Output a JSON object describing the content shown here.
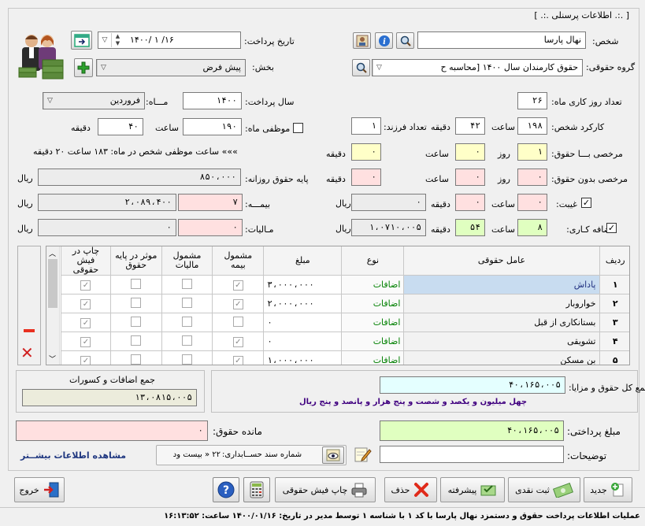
{
  "window_title": "[ .:. اطلاعات پرسنلی .:. ]",
  "person": {
    "label": "شخص:",
    "value": "نهال پارسا"
  },
  "pay_date": {
    "label": "تاریخ پرداخت:",
    "value": "۱۴۰۰/ ۱ /۱۶"
  },
  "salary_group": {
    "label": "گروه حقوقی:",
    "value": "حقوق کارمندان سال ۱۴۰۰ [محاسبه ح"
  },
  "section": {
    "label": "بخش:",
    "value": "پیش فرض"
  },
  "month_work_days": {
    "label": "تعداد روز کاری ماه:",
    "value": "۲۶"
  },
  "pay_year": {
    "label": "سال پرداخت:",
    "value": "۱۴۰۰"
  },
  "month": {
    "label": "مـــاه:",
    "value": "فروردین"
  },
  "person_work": {
    "label": "کارکرد شخص:",
    "hours": "۱۹۸",
    "hours_unit": "ساعت",
    "minutes": "۴۲",
    "minutes_unit": "دقیقه"
  },
  "children": {
    "label": "تعداد فرزند:",
    "value": "۱"
  },
  "month_duty": {
    "label": "موظفی ماه:",
    "hours": "۱۹۰",
    "hours_unit": "ساعت",
    "minutes": "۴۰",
    "minutes_unit": "دقیقه"
  },
  "leave_paid": {
    "label": "مرخصی بـــا حقوق:",
    "days": "۱",
    "days_unit": "روز",
    "hours": "۰",
    "hours_unit": "ساعت",
    "minutes": "۰",
    "minutes_unit": "دقیقه"
  },
  "over_duty_text": "»»» ساعت موظفی شخص در ماه: ۱۸۳ ساعت ۲۰ دقیقه",
  "leave_unpaid": {
    "label": "مرخصی بدون حقوق:",
    "days": "۰",
    "days_unit": "روز",
    "hours": "۰",
    "hours_unit": "ساعت",
    "minutes": "۰",
    "minutes_unit": "دقیقه"
  },
  "daily_base": {
    "label": "پایه حقوق روزانه:",
    "value": "۸۵۰،۰۰۰",
    "unit": "ریال"
  },
  "absence": {
    "label": "غیبت:",
    "checked": true,
    "hours": "۰",
    "hours_unit": "ساعت",
    "minutes": "۰",
    "minutes_unit": "دقیقه",
    "unit": "ریال"
  },
  "insurance": {
    "label": "بیمـــه:",
    "percent": "۷",
    "amount": "۲،۰۸۹،۴۰۰",
    "unit": "ریال"
  },
  "overtime": {
    "label": "اضافه کـاری:",
    "checked": true,
    "hours": "۸",
    "hours_unit": "ساعت",
    "minutes": "۵۴",
    "minutes_unit": "دقیقه",
    "amount": "۱،۰۷۱۰،۰۰۵",
    "unit": "ریال"
  },
  "tax": {
    "label": "مـالیات:",
    "percent": "۰",
    "amount": "۰",
    "unit": "ریال"
  },
  "table": {
    "headers": [
      "ردیف",
      "عامل حقوقی",
      "نوع",
      "مبلغ",
      "مشمول بیمه",
      "مشمول مالیات",
      "موثر در پایه حقوق",
      "چاپ در فیش حقوقی"
    ],
    "rows": [
      {
        "idx": "۱",
        "item": "پاداش",
        "type": "اضافات",
        "amount": "۳،۰۰۰،۰۰۰",
        "ins": true,
        "tax": false,
        "base": false,
        "print": true
      },
      {
        "idx": "۲",
        "item": "خواروبار",
        "type": "اضافات",
        "amount": "۲،۰۰۰،۰۰۰",
        "ins": true,
        "tax": false,
        "base": false,
        "print": true
      },
      {
        "idx": "۳",
        "item": "بستانکاری از قبل",
        "type": "اضافات",
        "amount": "۰",
        "ins": false,
        "tax": false,
        "base": false,
        "print": true
      },
      {
        "idx": "۴",
        "item": "تشویقی",
        "type": "اضافات",
        "amount": "۰",
        "ins": true,
        "tax": false,
        "base": false,
        "print": true
      },
      {
        "idx": "۵",
        "item": "بن مسکن",
        "type": "اضافات",
        "amount": "۱،۰۰۰،۰۰۰",
        "ins": true,
        "tax": false,
        "base": false,
        "print": true
      }
    ]
  },
  "total_benefits": {
    "label": "جمع کل حقوق و مزایا:",
    "value": "۴۰،۱۶۵،۰۰۵",
    "words": "چهل  میلیون و یکصد و شصت و پنج هزار و پانصد و  پنج ریال"
  },
  "total_add_deduct": {
    "label": "جمع اضافات و کسورات",
    "value": "۱۳،۰۸۱۵،۰۰۵"
  },
  "pay_amount": {
    "label": "مبلغ پرداختی:",
    "value": "۴۰،۱۶۵،۰۰۵"
  },
  "remaining": {
    "label": "مانده حقوق:",
    "value": "۰"
  },
  "description": {
    "label": "توضیحات:",
    "value": ""
  },
  "voucher": {
    "label": "شماره سند حســابداری:",
    "value": "۲۲ « بیست ود"
  },
  "more_info": "مشاهده اطلاعات بیشــتر",
  "buttons": {
    "new": "جدید",
    "cash": "ثبت نقدی",
    "advanced": "پیشرفته",
    "delete": "حذف",
    "print_slip": "چاپ فیش حقوقی",
    "exit": "خروج"
  },
  "status_bar": "عملیات  اطلاعات پرداخت حقوق و دستمزد نهال پارسا با کد ۱ با شناسه ۱ توسط مدیر در تاریخ: ۱۴۰۰/۰۱/۱۶ ساعت: ۱۶:۱۳:۵۲",
  "colors": {
    "accent": "#2040a0",
    "add_green": "#00a000",
    "delete_red": "#d02020",
    "pink_field": "#ffe0e0",
    "yellow_field": "#ffffc8",
    "green_field": "#e0ffc0"
  }
}
